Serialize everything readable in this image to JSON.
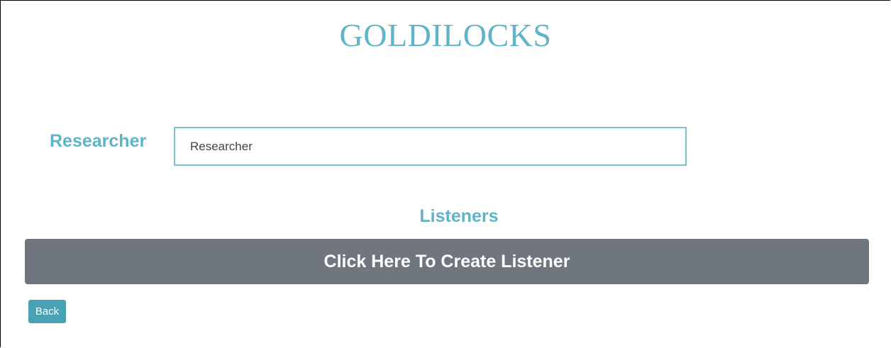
{
  "header": {
    "title": "GOLDILOCKS"
  },
  "researcher": {
    "label": "Researcher",
    "input_value": "",
    "input_placeholder": "Researcher"
  },
  "listeners": {
    "heading": "Listeners",
    "create_button_label": "Click Here To Create Listener"
  },
  "footer": {
    "back_label": "Back"
  },
  "colors": {
    "accent": "#5fb4c8",
    "input_border": "#7cc2d2",
    "create_button_bg": "#70767d",
    "back_button_bg": "#47a2b5"
  }
}
